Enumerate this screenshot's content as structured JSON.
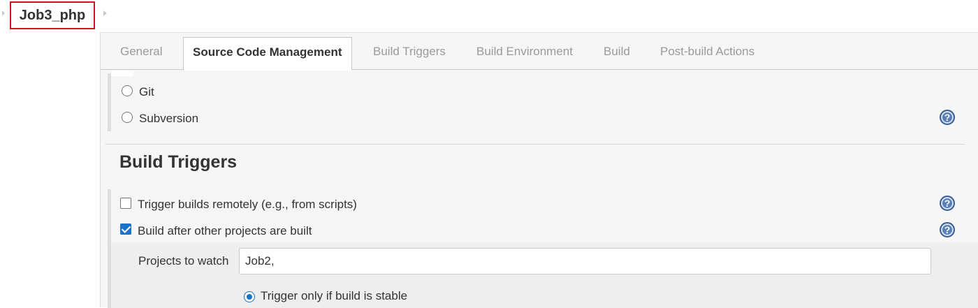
{
  "breadcrumb": {
    "job_name": "Job3_php"
  },
  "tabs": [
    {
      "label": "General",
      "active": false
    },
    {
      "label": "Source Code Management",
      "active": true
    },
    {
      "label": "Build Triggers",
      "active": false
    },
    {
      "label": "Build Environment",
      "active": false
    },
    {
      "label": "Build",
      "active": false
    },
    {
      "label": "Post-build Actions",
      "active": false
    }
  ],
  "scm": {
    "options": [
      {
        "label": "Git",
        "selected": false
      },
      {
        "label": "Subversion",
        "selected": false
      }
    ]
  },
  "build_triggers": {
    "title": "Build Triggers",
    "options": [
      {
        "label": "Trigger builds remotely (e.g., from scripts)",
        "checked": false
      },
      {
        "label": "Build after other projects are built",
        "checked": true
      }
    ],
    "projects_to_watch": {
      "label": "Projects to watch",
      "value": "Job2,"
    },
    "stability": {
      "label": "Trigger only if build is stable",
      "selected": true
    }
  },
  "icons": {
    "help": "help-icon",
    "help_glyph": "?"
  },
  "colors": {
    "highlight_border": "#d0161a",
    "accent": "#1a73c8",
    "help_blue": "#5a7fb7"
  }
}
